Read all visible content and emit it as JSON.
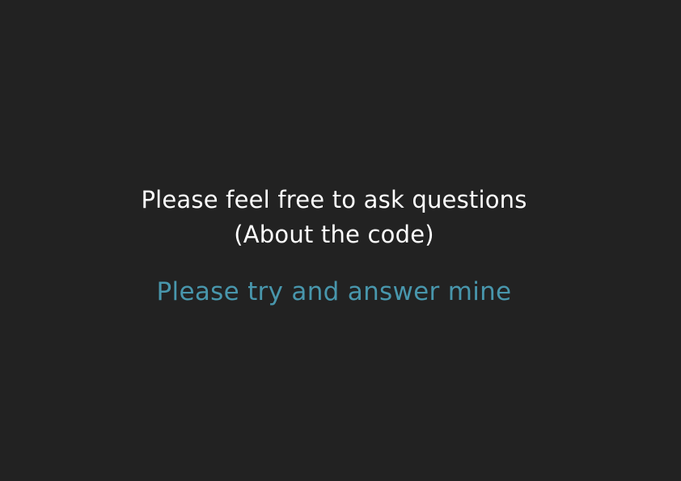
{
  "slide": {
    "background_color": "#222222",
    "heading_line_1": "Please feel free to ask questions",
    "heading_line_2": "(About the code)",
    "heading_color": "#ffffff",
    "subheading": "Please try and answer mine",
    "subheading_color": "#4896ac"
  }
}
